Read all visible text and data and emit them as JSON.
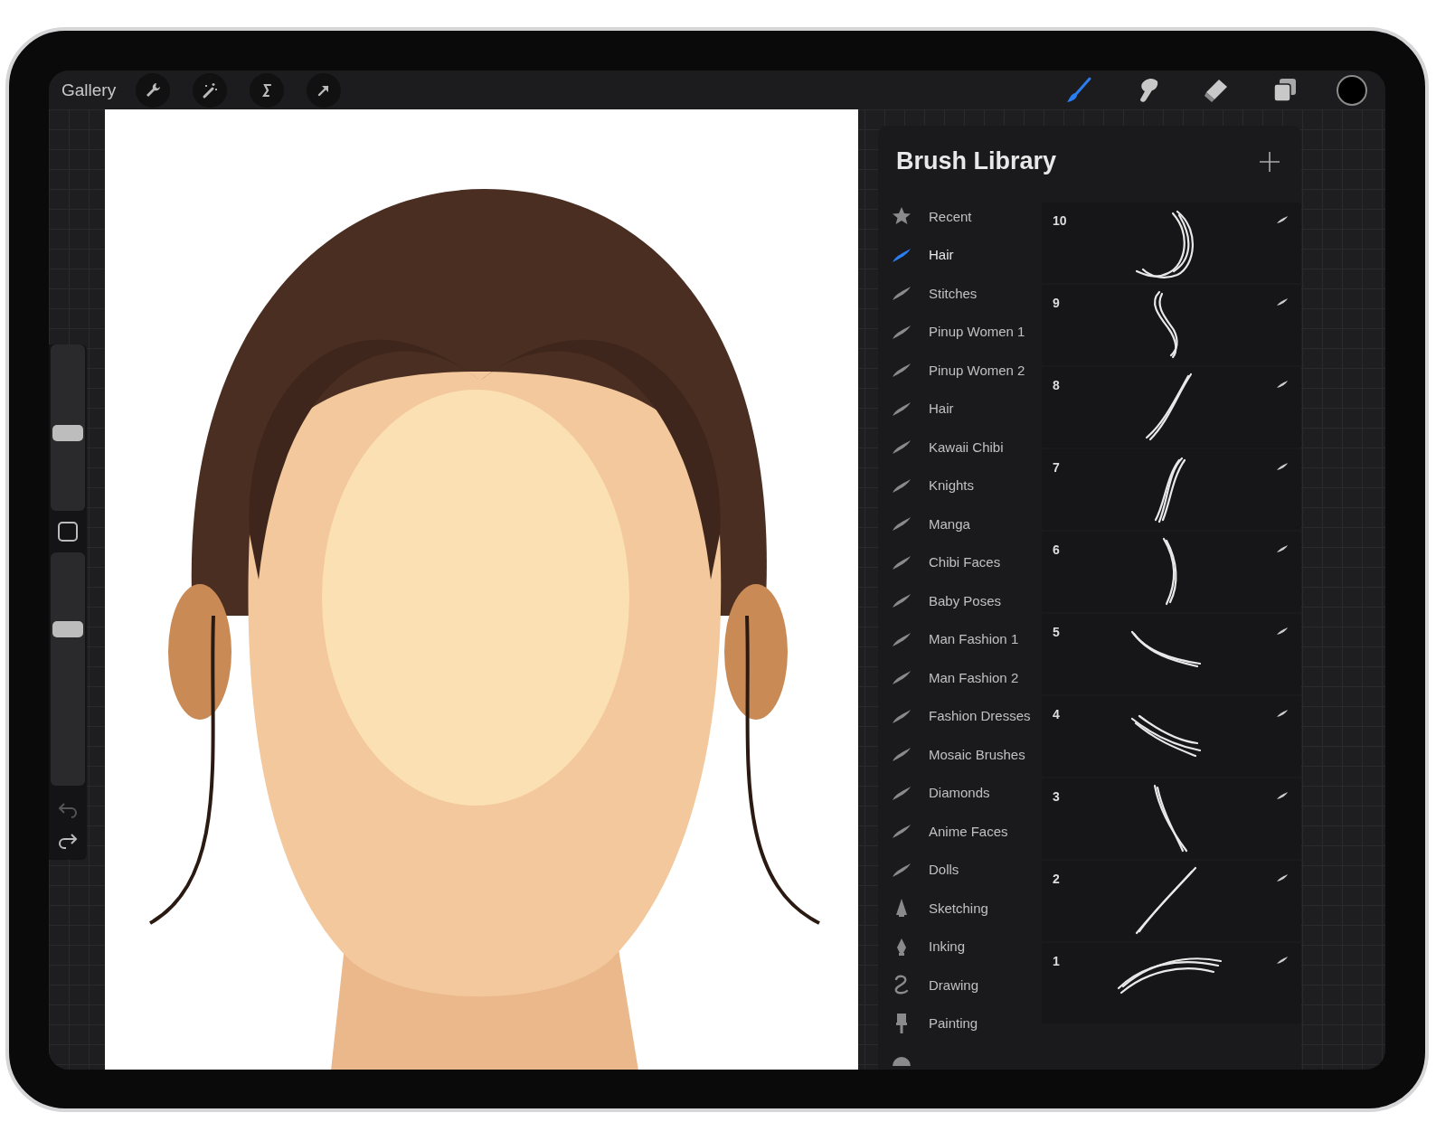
{
  "top_bar": {
    "gallery": "Gallery",
    "tools": [
      {
        "kind": "brush",
        "selected": true
      },
      {
        "kind": "smudge",
        "selected": false
      },
      {
        "kind": "eraser",
        "selected": false
      }
    ]
  },
  "sidebar": {
    "size_slider": {
      "level": 0.47
    },
    "opacity_slider": {
      "level": 0.67
    }
  },
  "brush_library": {
    "title": "Brush Library",
    "categories": [
      {
        "kind": "star",
        "label": "Recent",
        "selected": false
      },
      {
        "kind": "stroke",
        "label": "Hair",
        "selected": true
      },
      {
        "kind": "stroke",
        "label": "Stitches",
        "selected": false
      },
      {
        "kind": "stroke",
        "label": "Pinup Women 1",
        "selected": false
      },
      {
        "kind": "stroke",
        "label": "Pinup Women 2",
        "selected": false
      },
      {
        "kind": "stroke",
        "label": "Hair",
        "selected": false
      },
      {
        "kind": "stroke",
        "label": "Kawaii Chibi",
        "selected": false
      },
      {
        "kind": "stroke",
        "label": "Knights",
        "selected": false
      },
      {
        "kind": "stroke",
        "label": "Manga",
        "selected": false
      },
      {
        "kind": "stroke",
        "label": "Chibi Faces",
        "selected": false
      },
      {
        "kind": "stroke",
        "label": "Baby Poses",
        "selected": false
      },
      {
        "kind": "stroke",
        "label": "Man Fashion 1",
        "selected": false
      },
      {
        "kind": "stroke",
        "label": "Man Fashion 2",
        "selected": false
      },
      {
        "kind": "stroke",
        "label": "Fashion Dresses",
        "selected": false
      },
      {
        "kind": "stroke",
        "label": "Mosaic Brushes",
        "selected": false
      },
      {
        "kind": "stroke",
        "label": "Diamonds",
        "selected": false
      },
      {
        "kind": "stroke",
        "label": "Anime Faces",
        "selected": false
      },
      {
        "kind": "stroke",
        "label": "Dolls",
        "selected": false
      },
      {
        "kind": "cone",
        "label": "Sketching",
        "selected": false
      },
      {
        "kind": "nib",
        "label": "Inking",
        "selected": false
      },
      {
        "kind": "squiggle",
        "label": "Drawing",
        "selected": false
      },
      {
        "kind": "paintbrush",
        "label": "Painting",
        "selected": false
      },
      {
        "kind": "dome",
        "selected": false
      }
    ],
    "brushes": [
      {
        "name": "10"
      },
      {
        "name": "9"
      },
      {
        "name": "8"
      },
      {
        "name": "7"
      },
      {
        "name": "6"
      },
      {
        "name": "5"
      },
      {
        "name": "4"
      },
      {
        "name": "3"
      },
      {
        "name": "2"
      },
      {
        "name": "1"
      }
    ]
  }
}
